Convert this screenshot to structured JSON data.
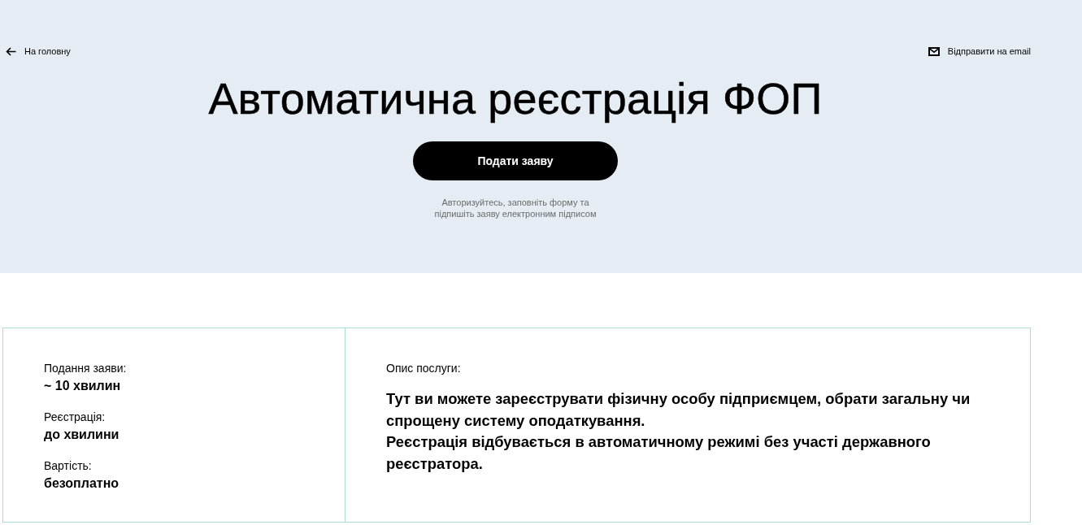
{
  "header": {
    "back_link": "На головну",
    "email_link": "Відправити на email"
  },
  "hero": {
    "title": "Автоматична реєстрація ФОП",
    "apply_button": "Подати заяву",
    "hint_lines": [
      "Авторизуйтесь, заповніть форму та",
      "підпишіть заяву електронним підписом"
    ]
  },
  "details": [
    {
      "label": "Подання заяви:",
      "value": "~ 10 хвилин"
    },
    {
      "label": "Реєстрація:",
      "value": "до хвилини"
    },
    {
      "label": "Вартість:",
      "value": "безоплатно"
    }
  ],
  "description": {
    "heading": "Опис послуги:",
    "paragraphs": [
      "Тут ви можете зареєструвати фізичну особу підприємцем, обрати загальну чи спрощену систему оподаткування.",
      "Реєстрація відбувається в автоматичному режимі без участі державного реєстратора."
    ]
  }
}
